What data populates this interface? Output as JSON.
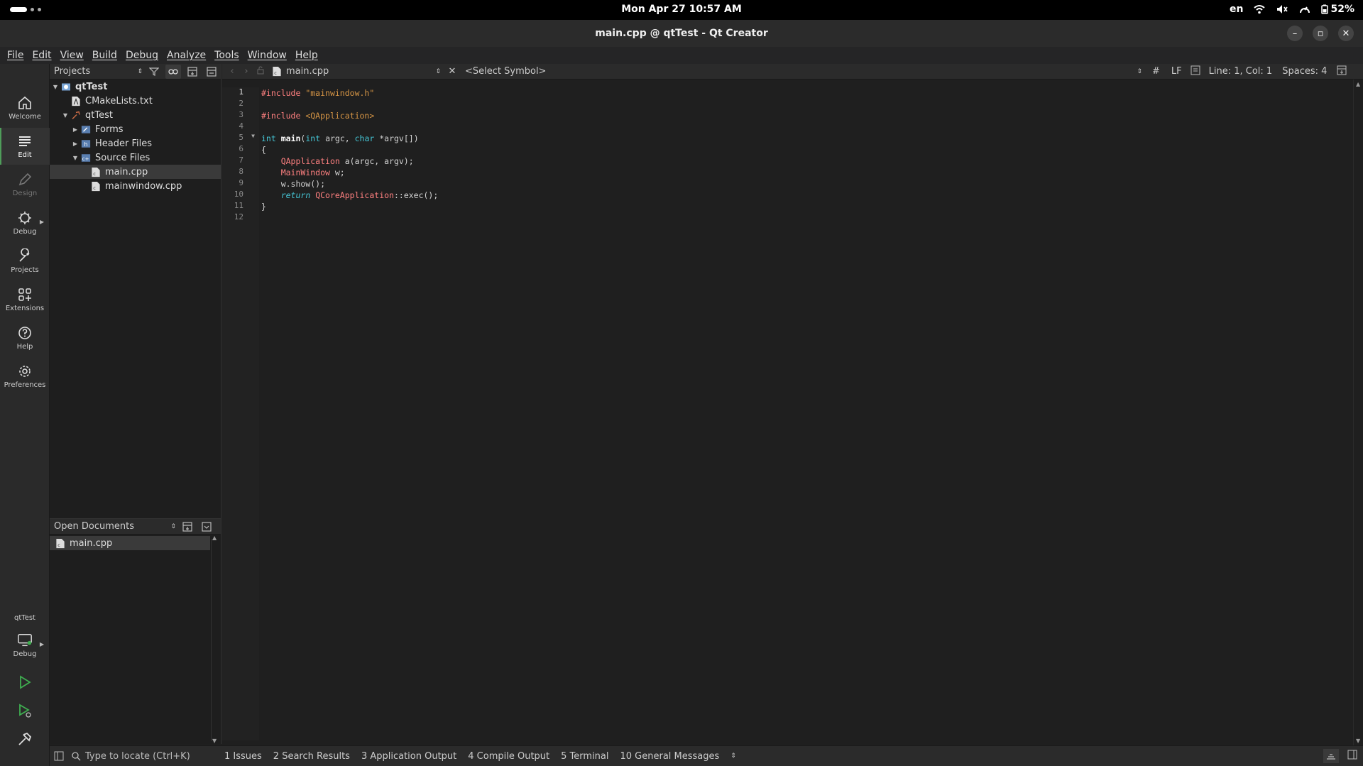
{
  "topbar": {
    "clock": "Mon Apr 27  10:57 AM",
    "lang": "en",
    "battery": "52%"
  },
  "window": {
    "title": "main.cpp @ qtTest - Qt Creator",
    "minimize": "–",
    "maximize": "▫",
    "close": "✕"
  },
  "menu": [
    "File",
    "Edit",
    "View",
    "Build",
    "Debug",
    "Analyze",
    "Tools",
    "Window",
    "Help"
  ],
  "modes": [
    {
      "label": "Welcome",
      "icon": "home-icon"
    },
    {
      "label": "Edit",
      "icon": "edit-icon"
    },
    {
      "label": "Design",
      "icon": "design-icon"
    },
    {
      "label": "Debug",
      "icon": "debug-icon"
    },
    {
      "label": "Projects",
      "icon": "wrench-icon"
    },
    {
      "label": "Extensions",
      "icon": "extensions-icon"
    },
    {
      "label": "Help",
      "icon": "help-icon"
    },
    {
      "label": "Preferences",
      "icon": "gear-icon"
    }
  ],
  "kit": {
    "project": "qtTest",
    "mode": "Debug"
  },
  "projects_pane": {
    "title": "Projects",
    "tree": [
      {
        "label": "qtTest",
        "depth": 0,
        "expanded": true
      },
      {
        "label": "CMakeLists.txt",
        "depth": 1
      },
      {
        "label": "qtTest",
        "depth": 1,
        "expanded": true
      },
      {
        "label": "Forms",
        "depth": 2,
        "expanded": false
      },
      {
        "label": "Header Files",
        "depth": 2,
        "expanded": false
      },
      {
        "label": "Source Files",
        "depth": 2,
        "expanded": true
      },
      {
        "label": "main.cpp",
        "depth": 3,
        "selected": true
      },
      {
        "label": "mainwindow.cpp",
        "depth": 3
      }
    ]
  },
  "open_documents": {
    "title": "Open Documents",
    "items": [
      "main.cpp"
    ]
  },
  "editor": {
    "file": "main.cpp",
    "symbol": "<Select Symbol>",
    "hash": "#",
    "eol": "LF",
    "cursor": "Line: 1, Col: 1",
    "indent": "Spaces: 4",
    "line_numbers": [
      "1",
      "2",
      "3",
      "4",
      "5",
      "6",
      "7",
      "8",
      "9",
      "10",
      "11",
      "12"
    ]
  },
  "status": {
    "locate_placeholder": "Type to locate (Ctrl+K)",
    "tabs": [
      "1  Issues",
      "2  Search Results",
      "3  Application Output",
      "4  Compile Output",
      "5  Terminal",
      "10  General Messages"
    ]
  }
}
